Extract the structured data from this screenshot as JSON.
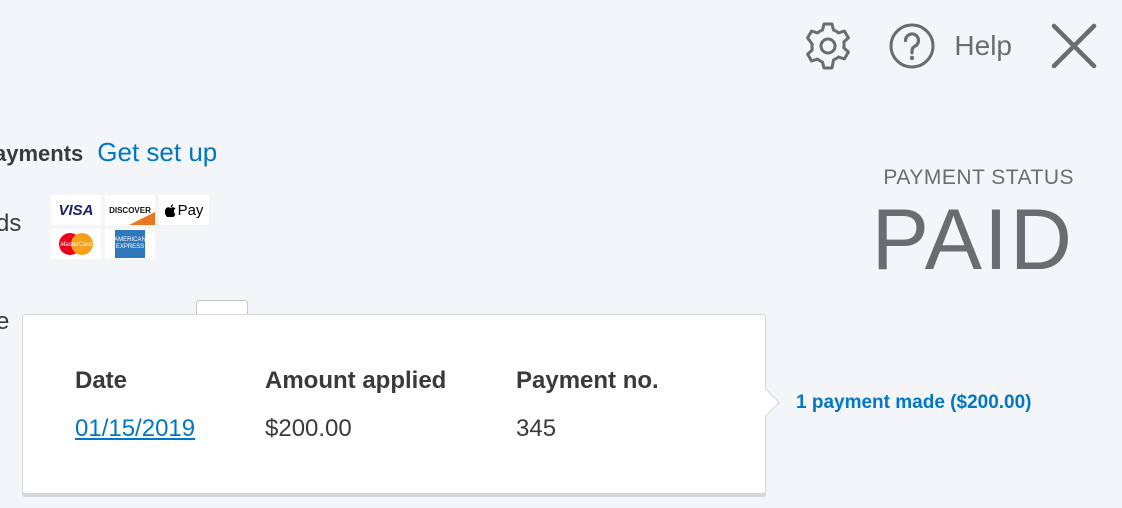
{
  "topbar": {
    "icons": {
      "settings": "gear-icon",
      "help": "help-circle-icon",
      "close": "close-icon"
    },
    "help_label": "Help"
  },
  "online_payments": {
    "title_fragment": "ayments",
    "setup_link": "Get set up",
    "methods_label_fragment": "ds",
    "cards": [
      "VISA",
      "DISCOVER",
      "Pay",
      "MasterCard",
      "AMERICAN EXPRESS"
    ],
    "partial_text": "e"
  },
  "payment_status": {
    "label": "PAYMENT STATUS",
    "value": "PAID"
  },
  "payments_made_link": "1 payment made ($200.00)",
  "popover": {
    "columns": [
      "Date",
      "Amount applied",
      "Payment no."
    ],
    "rows": [
      {
        "date": "01/15/2019",
        "amount": "$200.00",
        "payment_no": "345"
      }
    ]
  },
  "colors": {
    "link": "#0077c5",
    "text": "#393a3d",
    "muted": "#6b6c72",
    "background": "#f4f5f8"
  }
}
